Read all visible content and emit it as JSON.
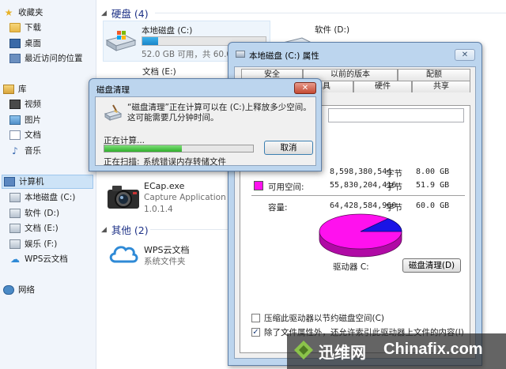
{
  "sidebar": {
    "favorites_label": "收藏夹",
    "favorites": [
      {
        "label": "下载"
      },
      {
        "label": "桌面"
      },
      {
        "label": "最近访问的位置"
      }
    ],
    "libraries_label": "库",
    "libraries": [
      {
        "label": "视频"
      },
      {
        "label": "图片"
      },
      {
        "label": "文档"
      },
      {
        "label": "音乐"
      }
    ],
    "computer_label": "计算机",
    "drives": [
      {
        "label": "本地磁盘 (C:)"
      },
      {
        "label": "软件 (D:)"
      },
      {
        "label": "文档 (E:)"
      },
      {
        "label": "娱乐 (F:)"
      },
      {
        "label": "WPS云文档"
      }
    ],
    "network_label": "网络"
  },
  "main": {
    "hard_disks_header": "硬盘 (4)",
    "drive_c": {
      "name": "本地磁盘 (C:)",
      "free_text": "52.0 GB 可用，共 60.0",
      "used_fraction": 0.13
    },
    "drive_d": {
      "name": "软件 (D:)"
    },
    "drive_e": {
      "name": "文档 (E:)"
    },
    "app": {
      "name": "ECap.exe",
      "description": "Capture Application",
      "version": "1.0.1.4"
    },
    "other_header": "其他 (2)",
    "wps": {
      "name": "WPS云文档",
      "folder_type": "系统文件夹"
    }
  },
  "properties": {
    "title": "本地磁盘 (C:) 属性",
    "close": "✕",
    "tabs_row1": [
      "安全",
      "以前的版本",
      "配额"
    ],
    "tabs_row2": [
      "常规",
      "工具",
      "硬件",
      "共享"
    ],
    "used_bytes": "8,598,380,544",
    "used_size": "8.00 GB",
    "free_label": "可用空间:",
    "free_bytes": "55,830,204,416",
    "free_size": "51.9 GB",
    "capacity_label": "容量:",
    "capacity_bytes": "64,428,584,960",
    "capacity_size": "60.0 GB",
    "byte_unit": "字节",
    "drive_label": "驱动器 C:",
    "cleanup_button": "磁盘清理(D)",
    "compress_label": "压缩此驱动器以节约磁盘空间(C)",
    "compress_checked": false,
    "index_label": "除了文件属性外，还允许索引此驱动器上文件的内容(I)",
    "index_checked": true,
    "colors": {
      "used": "#1a14e6",
      "free": "#ff11ee"
    }
  },
  "cleanup": {
    "title": "磁盘清理",
    "close": "✕",
    "message": "“磁盘清理”正在计算可以在 (C:)上释放多少空间。这可能需要几分钟时间。",
    "calculating": "正在计算...",
    "cancel_button": "取消",
    "scanning_label": "正在扫描:",
    "scanning_item": "系统错误内存转储文件",
    "progress_fraction": 0.52
  },
  "watermark": {
    "cn": "迅维网",
    "en": "Chinafix.com"
  }
}
